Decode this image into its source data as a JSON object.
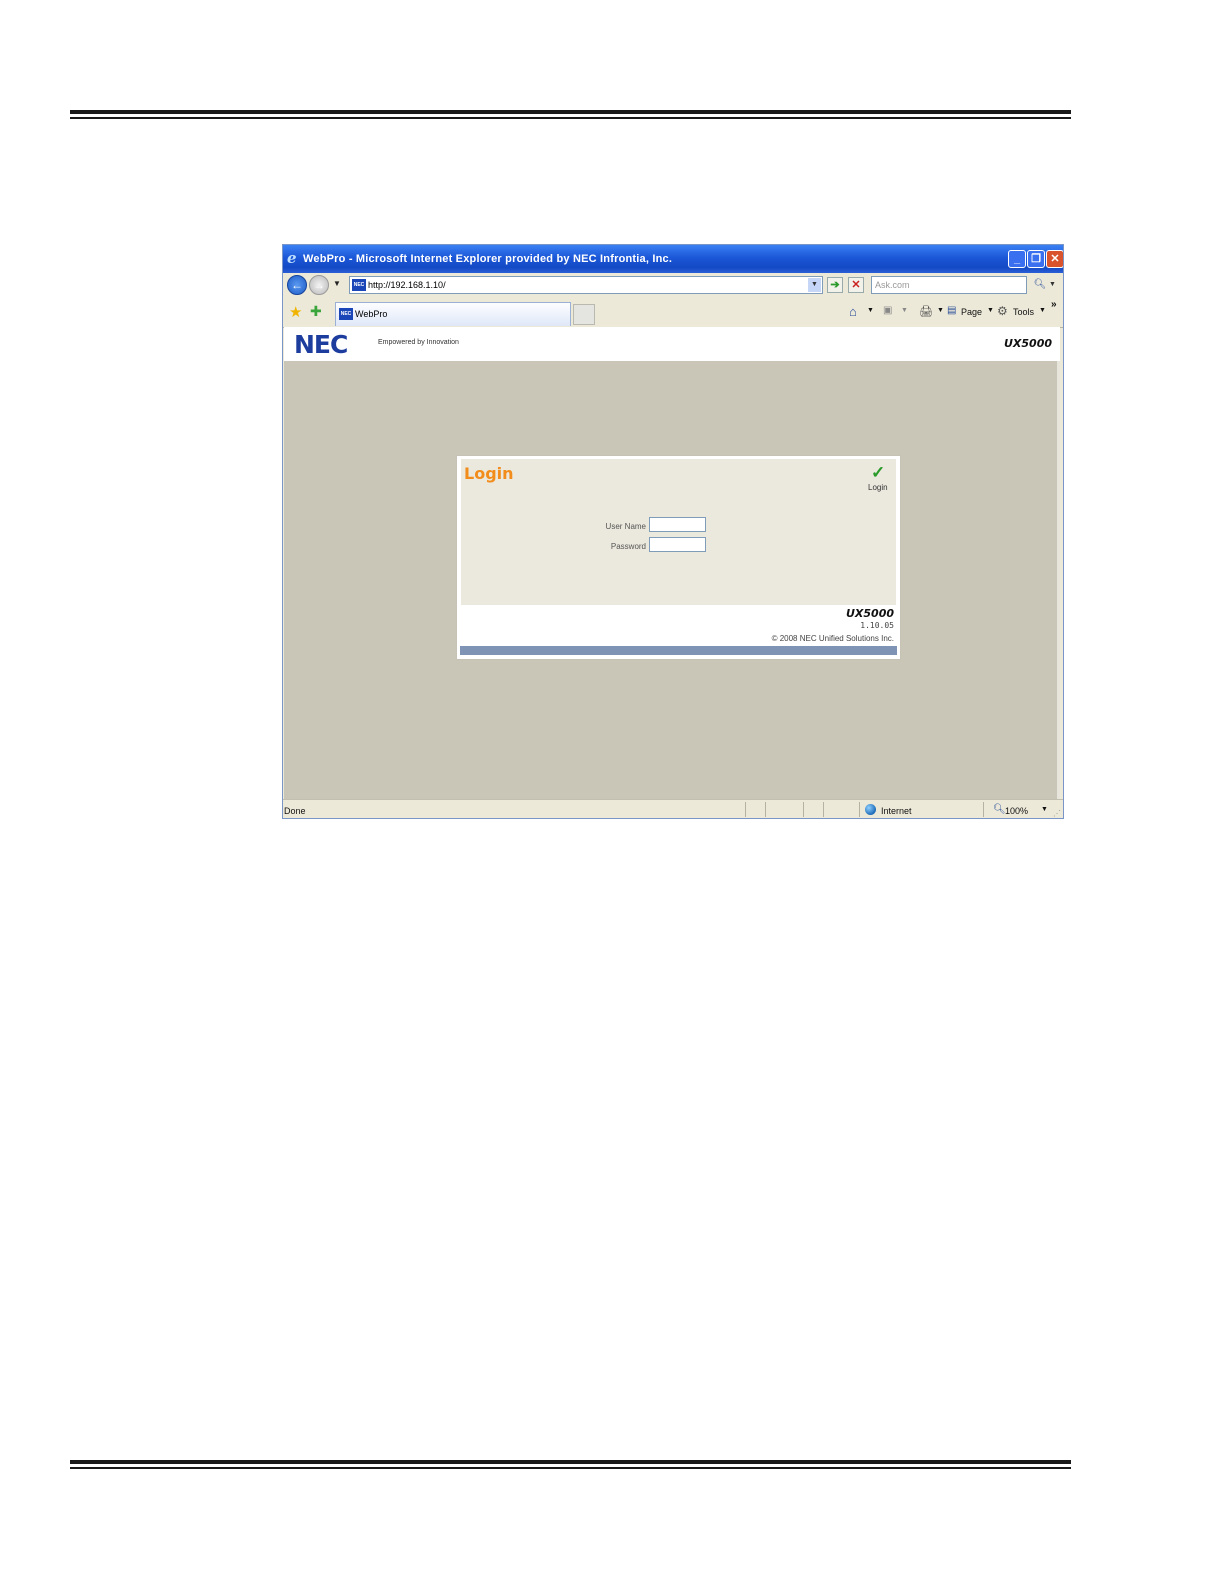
{
  "window": {
    "title": "WebPro - Microsoft Internet Explorer provided by NEC Infrontia, Inc.",
    "minimize_glyph": "_",
    "maximize_glyph": "❐",
    "close_glyph": "✕"
  },
  "address_bar": {
    "url": "http://192.168.1.10/",
    "favicon_text": "NEC",
    "search_placeholder": "Ask.com"
  },
  "tab": {
    "label": "WebPro",
    "favicon_text": "NEC"
  },
  "command_bar": {
    "home_icon": "home-icon",
    "feeds_icon": "feeds-icon",
    "print_icon": "print-icon",
    "page_label": "Page",
    "tools_label": "Tools",
    "more_glyph": "»"
  },
  "page_header": {
    "logo": "NEC",
    "tagline": "Empowered by Innovation",
    "product": "UX5000"
  },
  "login": {
    "title": "Login",
    "action_label": "Login",
    "username_label": "User Name",
    "password_label": "Password",
    "username_value": "",
    "password_value": "",
    "product": "UX5000",
    "version": "1.10.05",
    "copyright": "© 2008 NEC Unified Solutions Inc."
  },
  "status_bar": {
    "status": "Done",
    "zone": "Internet",
    "zoom": "100%"
  },
  "colors": {
    "titlebar": "#1b57d8",
    "nec_blue": "#1c3c9e",
    "login_orange": "#f28c1a",
    "content_bg": "#c9c5b7",
    "footer_bar": "#7f93b5"
  }
}
